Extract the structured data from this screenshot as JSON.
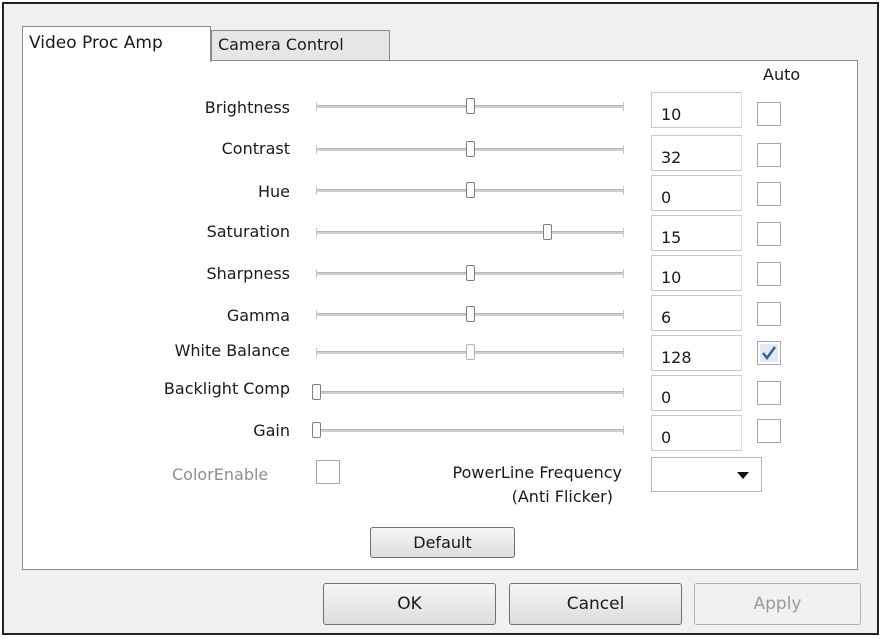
{
  "tabs": [
    {
      "label": "Video Proc Amp",
      "active": true
    },
    {
      "label": "Camera Control",
      "active": false
    }
  ],
  "auto_header": "Auto",
  "properties": [
    {
      "label": "Brightness",
      "value": "10",
      "slider_fraction": 0.5,
      "auto": false
    },
    {
      "label": "Contrast",
      "value": "32",
      "slider_fraction": 0.5,
      "auto": false
    },
    {
      "label": "Hue",
      "value": "0",
      "slider_fraction": 0.5,
      "auto": false
    },
    {
      "label": "Saturation",
      "value": "15",
      "slider_fraction": 0.75,
      "auto": false
    },
    {
      "label": "Sharpness",
      "value": "10",
      "slider_fraction": 0.5,
      "auto": false
    },
    {
      "label": "Gamma",
      "value": "6",
      "slider_fraction": 0.5,
      "auto": false
    },
    {
      "label": "White Balance",
      "value": "128",
      "slider_fraction": 0.5,
      "auto": true
    },
    {
      "label": "Backlight Comp",
      "value": "0",
      "slider_fraction": 0.0,
      "auto": false
    },
    {
      "label": "Gain",
      "value": "0",
      "slider_fraction": 0.0,
      "auto": false
    }
  ],
  "color_enable": {
    "label": "ColorEnable",
    "checked": false
  },
  "powerline": {
    "label_line1": "PowerLine Frequency",
    "label_line2": "(Anti Flicker)",
    "selected": ""
  },
  "buttons": {
    "default": "Default",
    "ok": "OK",
    "cancel": "Cancel",
    "apply": "Apply"
  },
  "colors": {
    "check": "#3b5a9a",
    "disabled_text": "#8e8e8e"
  }
}
